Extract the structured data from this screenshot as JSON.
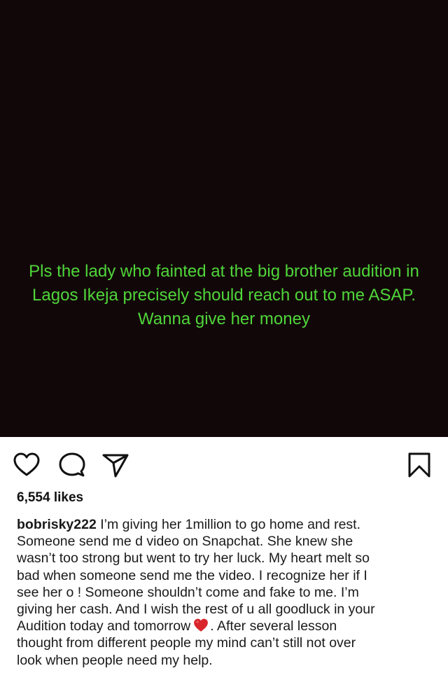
{
  "story_text": {
    "lines": [
      "Pls the lady who fainted at the big brother audition in",
      "Lagos Ikeja precisely should reach out to me ASAP.",
      "Wanna give her money"
    ]
  },
  "colors": {
    "image_background": "#120708",
    "story_text": "#4fd63b",
    "heart_emoji": "#d8262b"
  },
  "actions": {
    "like_icon": "heart-outline",
    "comment_icon": "speech-bubble",
    "share_icon": "paper-plane",
    "save_icon": "bookmark"
  },
  "likes": "6,554 likes",
  "caption": {
    "username": "bobrisky222",
    "lines": [
      " I’m giving her 1million to go home and rest.",
      "Someone send me d video on Snapchat. She knew she",
      "wasn’t too strong but went to try her luck. My heart melt so",
      "bad when someone send me the video. I recognize her if I",
      "see her o ! Someone shouldn’t come and fake to me. I’m",
      "giving her cash. And I wish the rest of u all goodluck in your"
    ],
    "line7_before_emoji": "Audition today and tomorrow",
    "emoji": "red-heart-emoji",
    "line7_after_emoji": ". After several lesson",
    "tail_lines": [
      "thought from different people my mind can’t still not over",
      "look when people need my help."
    ]
  }
}
